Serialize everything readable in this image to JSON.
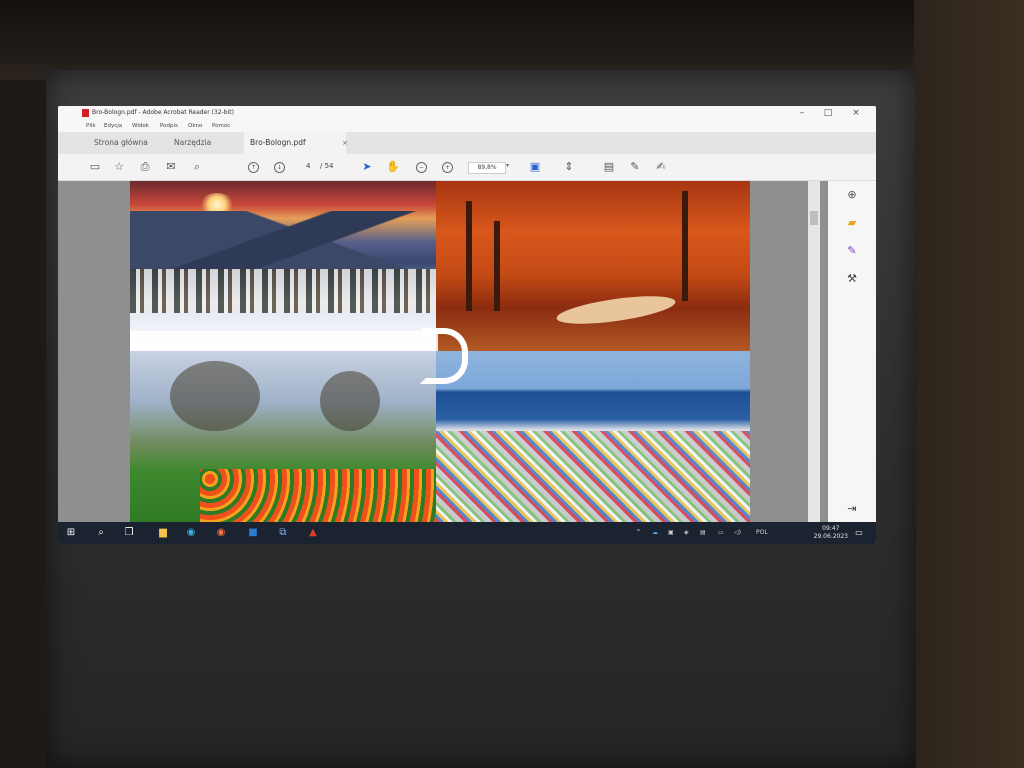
{
  "window": {
    "title": "Bro-Bologn.pdf - Adobe Acrobat Reader (32-bit)",
    "app_icon": "acrobat-icon",
    "minimize": "–",
    "maximize": "□",
    "close": "×"
  },
  "menu": [
    "Plik",
    "Edycja",
    "Widok",
    "Podpis",
    "Okno",
    "Pomoc"
  ],
  "tabs": [
    {
      "label": "Strona główna"
    },
    {
      "label": "Narzędzia"
    },
    {
      "label": "Bro-Bologn.pdf",
      "active": true,
      "close": "×"
    }
  ],
  "toolbar": {
    "page_current": "4",
    "page_total": "/ 54",
    "zoom": "89,8%"
  },
  "taskbar": {
    "lang": "POL",
    "time": "09:47",
    "date": "29.06.2023"
  },
  "colors": {
    "accent": "#2a5fd1",
    "acrobat_red": "#d21f26",
    "taskbar": "#1b2330"
  }
}
